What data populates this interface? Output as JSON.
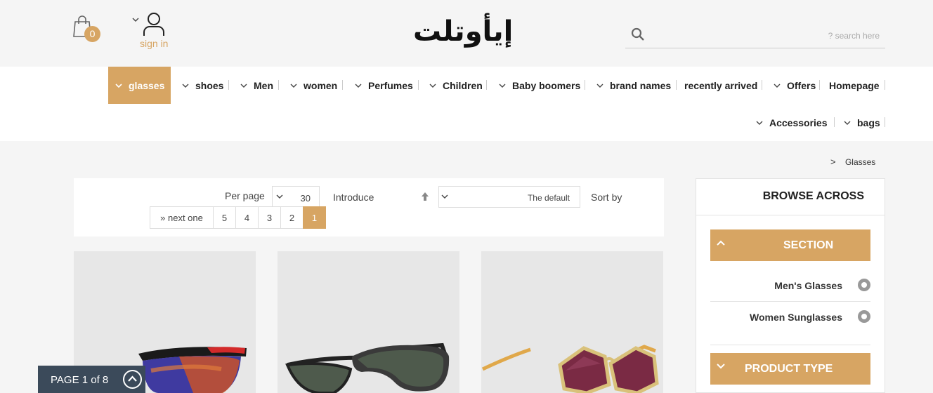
{
  "header": {
    "cart_count": "0",
    "sign_in": "sign in",
    "logo_text": "إيأوتلت",
    "search_placeholder": "? search here"
  },
  "nav": {
    "items": [
      {
        "label": "glasses",
        "active": true
      },
      {
        "label": "shoes"
      },
      {
        "label": "Men"
      },
      {
        "label": "women"
      },
      {
        "label": "Perfumes"
      },
      {
        "label": "Children"
      },
      {
        "label": "Baby boomers"
      },
      {
        "label": "brand names"
      },
      {
        "label": "recently arrived"
      },
      {
        "label": "Offers"
      },
      {
        "label": "Homepage"
      },
      {
        "label": "Accessories"
      },
      {
        "label": "bags"
      }
    ]
  },
  "breadcrumb": {
    "separator": ">",
    "current": "Glasses"
  },
  "toolbar": {
    "per_page_label": "Per page",
    "per_page_value": "30",
    "introduce": "Introduce",
    "sort_value": "The default",
    "sort_by": "Sort by",
    "pager": [
      "» next one",
      "5",
      "4",
      "3",
      "2",
      "1"
    ],
    "active_page": "1"
  },
  "sidebar": {
    "title": "BROWSE ACROSS",
    "section_title": "SECTION",
    "options": [
      "Men's Glasses",
      "Women Sunglasses"
    ],
    "product_type_title": "PRODUCT TYPE"
  },
  "page_badge": "PAGE 1 of 8",
  "colors": {
    "accent": "#d7a563",
    "badge_bg": "#3b4a5a"
  }
}
